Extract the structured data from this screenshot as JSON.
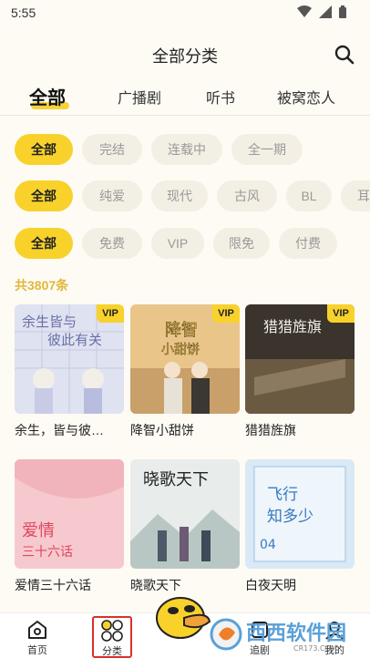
{
  "status": {
    "time": "5:55"
  },
  "header": {
    "title": "全部分类"
  },
  "top_tabs": [
    {
      "label": "全部"
    },
    {
      "label": "广播剧"
    },
    {
      "label": "听书"
    },
    {
      "label": "被窝恋人"
    }
  ],
  "filters": {
    "row1": [
      "全部",
      "完结",
      "连载中",
      "全一期"
    ],
    "row2": [
      "全部",
      "纯爱",
      "现代",
      "古风",
      "BL",
      "耳"
    ],
    "row3": [
      "全部",
      "免费",
      "VIP",
      "限免",
      "付费"
    ]
  },
  "count_text": "共3807条",
  "cards": [
    {
      "title": "余生，皆与彼…",
      "vip": "VIP",
      "cover_text": "余生皆与彼此有关"
    },
    {
      "title": "降智小甜饼",
      "vip": "VIP",
      "cover_text": "降智小甜饼"
    },
    {
      "title": "猎猎旌旗",
      "vip": "VIP",
      "cover_text": "猎猎旌旗"
    },
    {
      "title": "爱情三十六话",
      "vip": "",
      "cover_text": "爱情三十六话"
    },
    {
      "title": "晓歌天下",
      "vip": "",
      "cover_text": "晓歌天下"
    },
    {
      "title": "白夜天明",
      "vip": "",
      "cover_text": "飞行知多少"
    }
  ],
  "bottom_nav": {
    "home": "首页",
    "category": "分类",
    "tracking": "追剧",
    "mine": "我的"
  },
  "watermark": {
    "text": "西西软件园",
    "sub": "CR173.COM"
  },
  "colors": {
    "accent": "#f8d22b",
    "count": "#e2b73c",
    "highlight_border": "#d9312a"
  }
}
